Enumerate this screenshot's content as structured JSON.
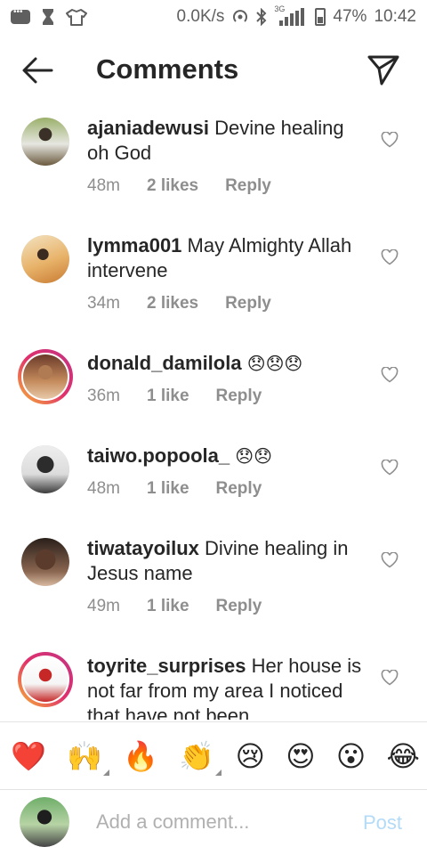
{
  "status_bar": {
    "speed": "0.0K/s",
    "network": "3G",
    "battery": "47%",
    "time": "10:42"
  },
  "header": {
    "title": "Comments"
  },
  "comments": [
    {
      "username": "ajaniadewusi",
      "text": "Devine healing oh God",
      "time": "48m",
      "likes": "2 likes",
      "reply": "Reply"
    },
    {
      "username": "lymma001",
      "text": "May Almighty Allah intervene",
      "time": "34m",
      "likes": "2 likes",
      "reply": "Reply"
    },
    {
      "username": "donald_damilola",
      "text": "😞😞😞",
      "time": "36m",
      "likes": "1 like",
      "reply": "Reply"
    },
    {
      "username": "taiwo.popoola_",
      "text": "😞😞",
      "time": "48m",
      "likes": "1 like",
      "reply": "Reply"
    },
    {
      "username": "tiwatayoilux",
      "text": "Divine healing in Jesus name",
      "time": "49m",
      "likes": "1 like",
      "reply": "Reply"
    },
    {
      "username": "toyrite_surprises",
      "text": "Her house is not far from my area I noticed that have not been",
      "time": "",
      "likes": "",
      "reply": ""
    }
  ],
  "emoji_bar": [
    "❤️",
    "🙌",
    "🔥",
    "👏",
    "😢",
    "😍",
    "😮",
    "😂"
  ],
  "composer": {
    "placeholder": "Add a comment...",
    "post_label": "Post"
  }
}
